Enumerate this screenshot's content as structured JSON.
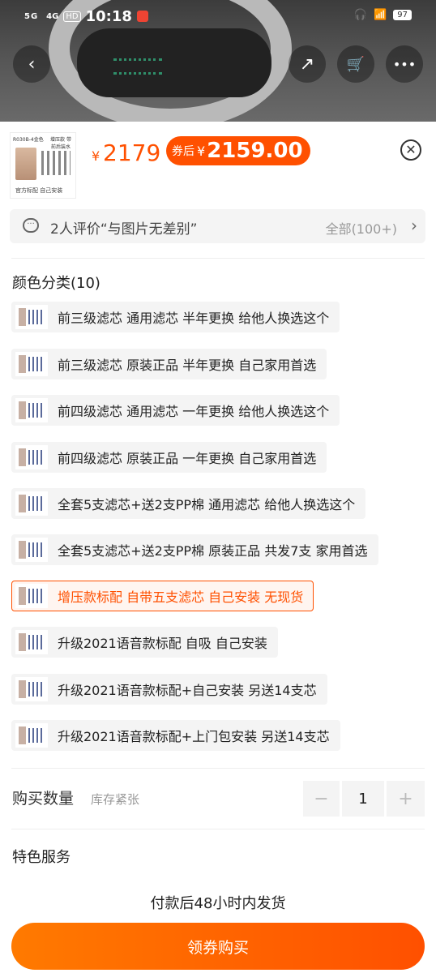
{
  "status_bar": {
    "signal1": "5G",
    "signal2": "4G",
    "hd": "HD",
    "time": "10:18",
    "battery": "97"
  },
  "top_actions": {
    "back": "‹",
    "share": "↗",
    "cart": "🛒",
    "more": "•••"
  },
  "product": {
    "thumb_tag": "R030B-4金色",
    "thumb_tag2": "增压款 带前后装水",
    "thumb_footer": "官方标配  自己安装",
    "price_symbol": "¥",
    "price": "2179",
    "coupon_label": "券后",
    "coupon_symbol": "¥",
    "coupon_price": "2159.00"
  },
  "review": {
    "text": "2人评价“与图片无差别”",
    "all": "全部(100+)"
  },
  "color_section": {
    "title": "颜色分类(10)",
    "options": [
      {
        "label": "前三级滤芯 通用滤芯 半年更换 给他人换选这个"
      },
      {
        "label": "前三级滤芯 原装正品 半年更换 自己家用首选"
      },
      {
        "label": "前四级滤芯 通用滤芯 一年更换 给他人换选这个"
      },
      {
        "label": "前四级滤芯 原装正品 一年更换 自己家用首选"
      },
      {
        "label": "全套5支滤芯+送2支PP棉 通用滤芯 给他人换选这个"
      },
      {
        "label": "全套5支滤芯+送2支PP棉 原装正品 共发7支 家用首选"
      },
      {
        "label": "增压款标配 自带五支滤芯 自己安装 无现货"
      },
      {
        "label": "升级2021语音款标配 自吸 自己安装"
      },
      {
        "label": "升级2021语音款标配+自己安装 另送14支芯"
      },
      {
        "label": "升级2021语音款标配+上门包安装 另送14支芯"
      }
    ],
    "selected_index": 6
  },
  "quantity": {
    "title": "购买数量",
    "note": "库存紧张",
    "minus": "−",
    "value": "1",
    "plus": "+"
  },
  "service": {
    "title": "特色服务"
  },
  "shipping": {
    "note": "付款后48小时内发货"
  },
  "buy": {
    "label": "领券购买"
  },
  "colors": {
    "accent": "#ff5000"
  }
}
